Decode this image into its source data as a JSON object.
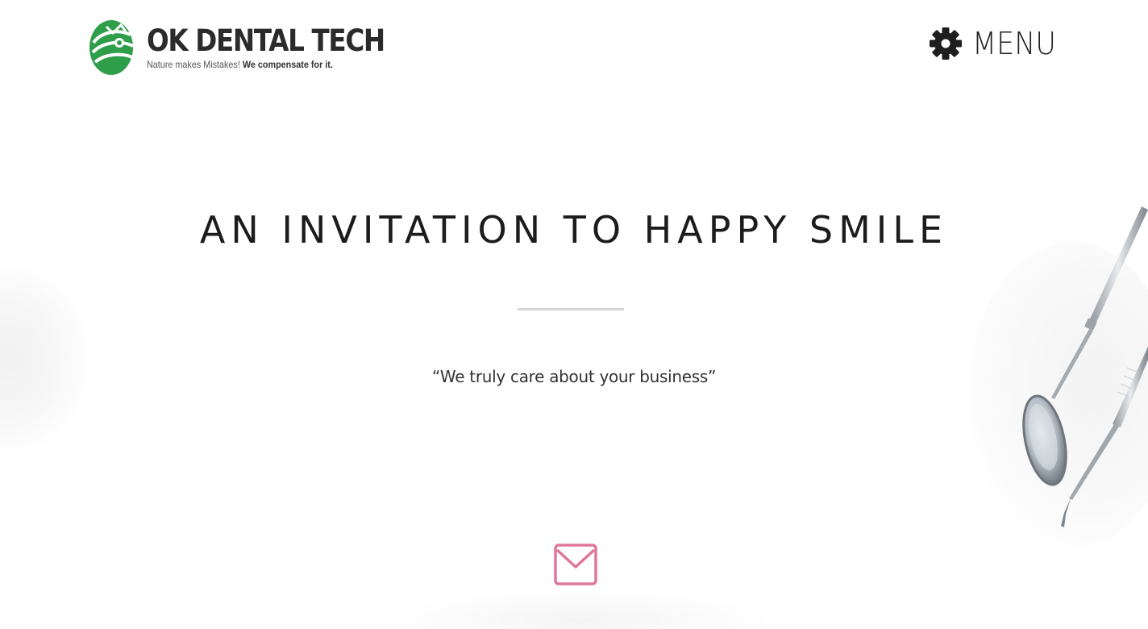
{
  "header": {
    "logo": {
      "title": "OK DENTAL TECH",
      "tagline_regular": "Nature makes Mistakes!",
      "tagline_bold": "We compensate for it.",
      "icon": "ok-dental-logo-icon",
      "color": "#2e9e4a"
    },
    "menu": {
      "label": "MENU",
      "icon": "gear-icon"
    }
  },
  "hero": {
    "title": "AN INVITATION TO HAPPY SMILE",
    "subtitle": "“We truly care about your business”",
    "contact_icon": "mail-icon",
    "contact_icon_color": "#e07799"
  },
  "background": {
    "illustration": "dental-instruments-icon"
  }
}
